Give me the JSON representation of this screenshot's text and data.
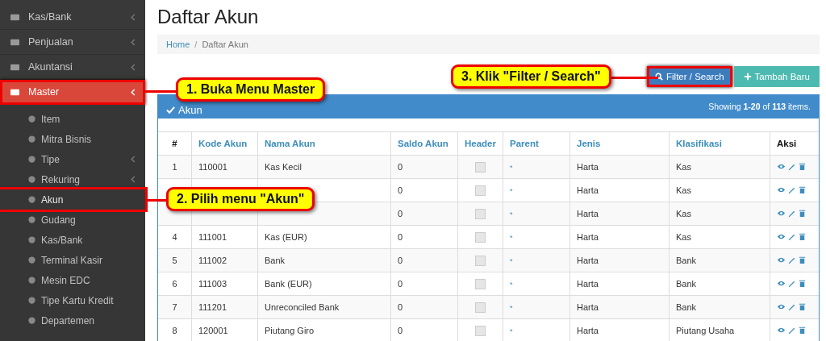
{
  "sidebar": {
    "items": [
      {
        "label": "Kas/Bank",
        "expandable": true,
        "selected": false,
        "highlighted": false
      },
      {
        "label": "Penjualan",
        "expandable": true,
        "selected": false,
        "highlighted": false
      },
      {
        "label": "Akuntansi",
        "expandable": true,
        "selected": false,
        "highlighted": false
      },
      {
        "label": "Master",
        "expandable": true,
        "selected": true,
        "highlighted": true,
        "expanded": true,
        "children": [
          {
            "label": "Item",
            "expandable": false,
            "selected": false,
            "highlighted": false
          },
          {
            "label": "Mitra Bisnis",
            "expandable": false,
            "selected": false,
            "highlighted": false
          },
          {
            "label": "Tipe",
            "expandable": true,
            "selected": false,
            "highlighted": false
          },
          {
            "label": "Rekuring",
            "expandable": true,
            "selected": false,
            "highlighted": false
          },
          {
            "label": "Akun",
            "expandable": false,
            "selected": true,
            "highlighted": true
          },
          {
            "label": "Gudang",
            "expandable": false,
            "selected": false,
            "highlighted": false
          },
          {
            "label": "Kas/Bank",
            "expandable": false,
            "selected": false,
            "highlighted": false
          },
          {
            "label": "Terminal Kasir",
            "expandable": false,
            "selected": false,
            "highlighted": false
          },
          {
            "label": "Mesin EDC",
            "expandable": false,
            "selected": false,
            "highlighted": false
          },
          {
            "label": "Tipe Kartu Kredit",
            "expandable": false,
            "selected": false,
            "highlighted": false
          },
          {
            "label": "Departemen",
            "expandable": false,
            "selected": false,
            "highlighted": false
          }
        ]
      }
    ]
  },
  "page_title": "Daftar Akun",
  "breadcrumb": {
    "separator": "/",
    "items": [
      {
        "label": "Home",
        "link": true
      },
      {
        "label": "Daftar Akun",
        "link": false
      }
    ]
  },
  "buttons": [
    {
      "label": "Filter / Search",
      "kind": "filter",
      "highlighted": true
    },
    {
      "label": "Tambah Baru",
      "kind": "add",
      "highlighted": false
    }
  ],
  "panel": {
    "title": "Akun",
    "summary": "Showing **1-20** of **113** items."
  },
  "table": {
    "columns": [
      {
        "label": "#",
        "sortable": false
      },
      {
        "label": "Kode Akun",
        "sortable": true
      },
      {
        "label": "Nama Akun",
        "sortable": true
      },
      {
        "label": "Saldo Akun",
        "sortable": true
      },
      {
        "label": "Header",
        "sortable": true
      },
      {
        "label": "Parent",
        "sortable": true
      },
      {
        "label": "Jenis",
        "sortable": true
      },
      {
        "label": "Klasifikasi",
        "sortable": true
      },
      {
        "label": "Aksi",
        "sortable": false
      }
    ],
    "rows": [
      {
        "no": "1",
        "kode": "110001",
        "nama": "Kas Kecil",
        "saldo": "0",
        "header": false,
        "parent": "*",
        "jenis": "Harta",
        "klasifikasi": "Kas"
      },
      {
        "saldo": "0",
        "header": false,
        "parent": "*",
        "jenis": "Harta",
        "klasifikasi": "Kas"
      },
      {
        "saldo": "0",
        "header": false,
        "parent": "*",
        "jenis": "Harta",
        "klasifikasi": "Kas"
      },
      {
        "no": "4",
        "kode": "111001",
        "nama": "Kas (EUR)",
        "saldo": "0",
        "header": false,
        "parent": "*",
        "jenis": "Harta",
        "klasifikasi": "Kas"
      },
      {
        "no": "5",
        "kode": "111002",
        "nama": "Bank",
        "saldo": "0",
        "header": false,
        "parent": "*",
        "jenis": "Harta",
        "klasifikasi": "Bank"
      },
      {
        "no": "6",
        "kode": "111003",
        "nama": "Bank (EUR)",
        "saldo": "0",
        "header": false,
        "parent": "*",
        "jenis": "Harta",
        "klasifikasi": "Bank"
      },
      {
        "no": "7",
        "kode": "111201",
        "nama": "Unreconciled Bank",
        "saldo": "0",
        "header": false,
        "parent": "*",
        "jenis": "Harta",
        "klasifikasi": "Bank"
      },
      {
        "no": "8",
        "kode": "120001",
        "nama": "Piutang Giro",
        "saldo": "0",
        "header": false,
        "parent": "*",
        "jenis": "Harta",
        "klasifikasi": "Piutang Usaha"
      }
    ]
  },
  "annotations": [
    {
      "text": "1. Buka Menu Master"
    },
    {
      "text": "2. Pilih menu \"Akun\""
    },
    {
      "text": "3. Klik \"Filter / Search\""
    }
  ]
}
